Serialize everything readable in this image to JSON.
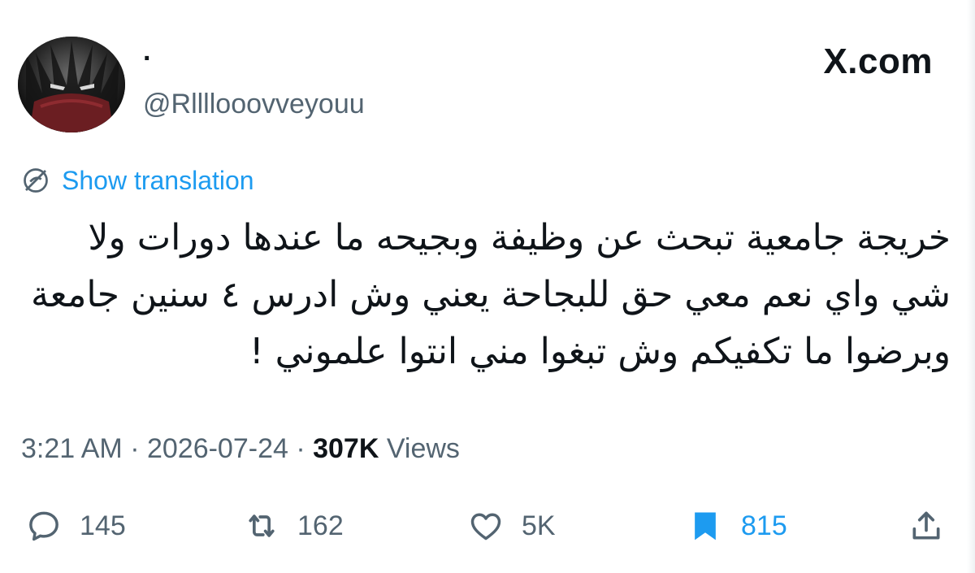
{
  "header": {
    "display_name": "·",
    "handle": "@Rllllooovveyouu",
    "brand": "X.com"
  },
  "translate": {
    "label": "Show translation"
  },
  "tweet": {
    "lines": [
      "خريجة جامعية تبحث عن وظيفة وبجيحه ما عندها دورات ولا",
      "شي واي نعم معي حق للبجاحة يعني وش ادرس ٤ سنين جامعة",
      "وبرضوا ما تكفيكم وش تبغوا مني انتوا علموني !"
    ]
  },
  "meta": {
    "time": "3:21 AM",
    "separator": " · ",
    "date": "2026-07-24",
    "views_count": "307K",
    "views_label": " Views"
  },
  "actions": {
    "replies": {
      "icon": "reply-icon",
      "count": "145"
    },
    "reposts": {
      "icon": "repost-icon",
      "count": "162"
    },
    "likes": {
      "icon": "heart-icon",
      "count": "5K"
    },
    "bookmarks": {
      "icon": "bookmark-icon",
      "count": "815",
      "active": true
    },
    "share": {
      "icon": "share-icon"
    }
  },
  "colors": {
    "accent": "#1d9bf0",
    "muted": "#536471",
    "text": "#0f1419"
  }
}
